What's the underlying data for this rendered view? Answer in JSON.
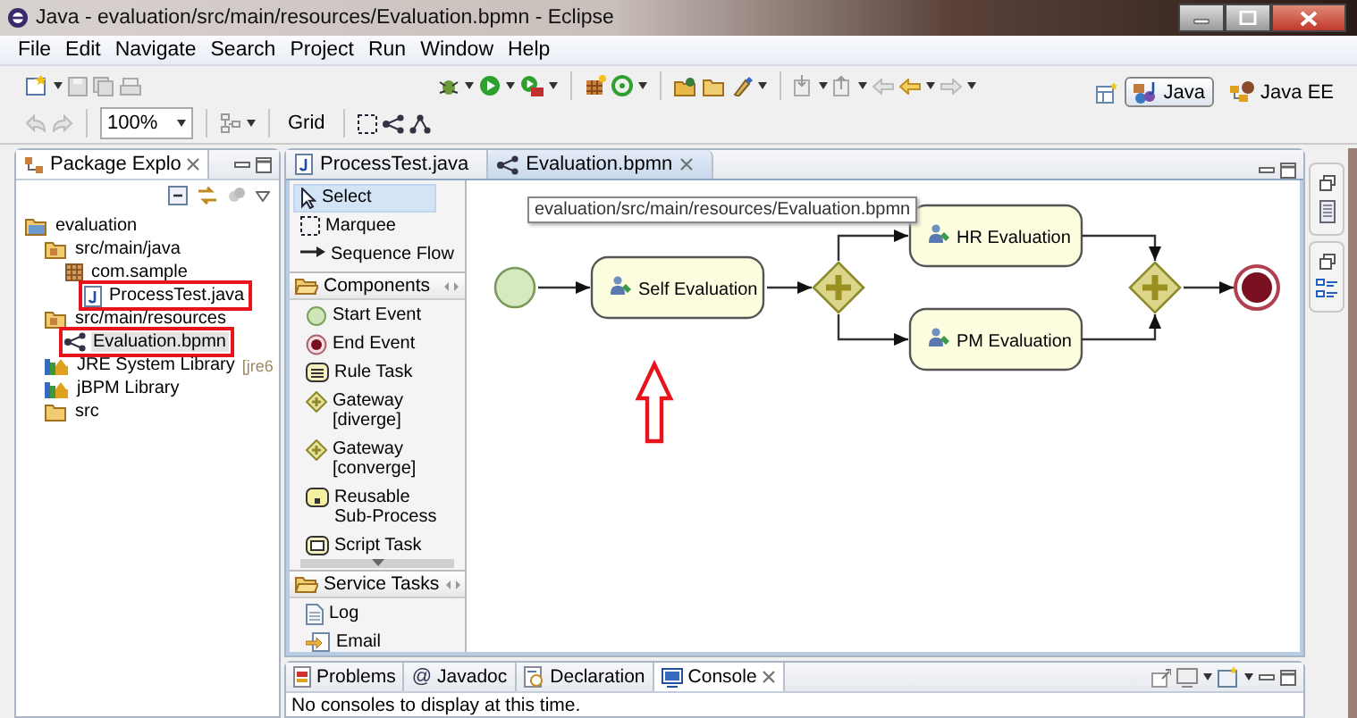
{
  "window": {
    "title": "Java - evaluation/src/main/resources/Evaluation.bpmn - Eclipse"
  },
  "menu": [
    "File",
    "Edit",
    "Navigate",
    "Search",
    "Project",
    "Run",
    "Window",
    "Help"
  ],
  "toolbar": {
    "zoom": "100%",
    "grid": "Grid"
  },
  "perspectives": [
    {
      "label": "Java",
      "selected": true
    },
    {
      "label": "Java EE",
      "selected": false
    }
  ],
  "package_explorer": {
    "title": "Package Explo",
    "tree": [
      {
        "label": "evaluation",
        "kind": "project",
        "selected": false,
        "annotated": false,
        "children": [
          {
            "label": "src/main/java",
            "kind": "source",
            "selected": false,
            "annotated": false,
            "children": [
              {
                "label": "com.sample",
                "kind": "package",
                "selected": false,
                "annotated": false,
                "children": [
                  {
                    "label": "ProcessTest.java",
                    "kind": "java",
                    "selected": false,
                    "annotated": true
                  }
                ]
              }
            ]
          },
          {
            "label": "src/main/resources",
            "kind": "source",
            "selected": false,
            "annotated": false,
            "children": [
              {
                "label": "Evaluation.bpmn",
                "kind": "bpmn",
                "selected": true,
                "annotated": true
              }
            ]
          },
          {
            "label": "JRE System Library",
            "decoration": "[jre6",
            "kind": "library",
            "selected": false,
            "annotated": false
          },
          {
            "label": "jBPM Library",
            "kind": "library",
            "selected": false,
            "annotated": false
          },
          {
            "label": "src",
            "kind": "folder",
            "selected": false,
            "annotated": false
          }
        ]
      }
    ]
  },
  "editor_tabs": [
    {
      "label": "ProcessTest.java",
      "kind": "java",
      "selected": false
    },
    {
      "label": "Evaluation.bpmn",
      "kind": "bpmn",
      "selected": true
    }
  ],
  "palette": {
    "tools": [
      {
        "label": "Select",
        "kind": "select",
        "selected": true
      },
      {
        "label": "Marquee",
        "kind": "marquee",
        "selected": false
      },
      {
        "label": "Sequence Flow",
        "kind": "flow",
        "selected": false
      }
    ],
    "drawers": [
      {
        "label": "Components",
        "expanded": true,
        "items": [
          {
            "label": "Start Event",
            "kind": "start"
          },
          {
            "label": "End Event",
            "kind": "end"
          },
          {
            "label": "Rule Task",
            "kind": "rule"
          },
          {
            "label": "Gateway [diverge]",
            "kind": "gateway"
          },
          {
            "label": "Gateway [converge]",
            "kind": "gateway"
          },
          {
            "label": "Reusable Sub-Process",
            "kind": "subprocess"
          },
          {
            "label": "Script Task",
            "kind": "script"
          }
        ]
      },
      {
        "label": "Service Tasks",
        "expanded": true,
        "items": [
          {
            "label": "Log",
            "kind": "log"
          },
          {
            "label": "Email",
            "kind": "email"
          }
        ]
      }
    ]
  },
  "diagram": {
    "tooltip": "evaluation/src/main/resources/Evaluation.bpmn",
    "process": [
      {
        "kind": "start"
      },
      {
        "kind": "task",
        "label": "Self Evaluation"
      },
      {
        "kind": "gateway"
      },
      {
        "kind": "parallel",
        "branches": [
          {
            "kind": "task",
            "label": "HR Evaluation"
          },
          {
            "kind": "task",
            "label": "PM Evaluation"
          }
        ]
      },
      {
        "kind": "gateway"
      },
      {
        "kind": "end"
      }
    ]
  },
  "bottom_panel": {
    "tabs": [
      {
        "label": "Problems",
        "kind": "problems",
        "selected": false
      },
      {
        "label": "Javadoc",
        "kind": "javadoc",
        "glyph": "@",
        "selected": false
      },
      {
        "label": "Declaration",
        "kind": "declaration",
        "selected": false
      },
      {
        "label": "Console",
        "kind": "console",
        "selected": true
      }
    ],
    "message": "No consoles to display at this time."
  }
}
